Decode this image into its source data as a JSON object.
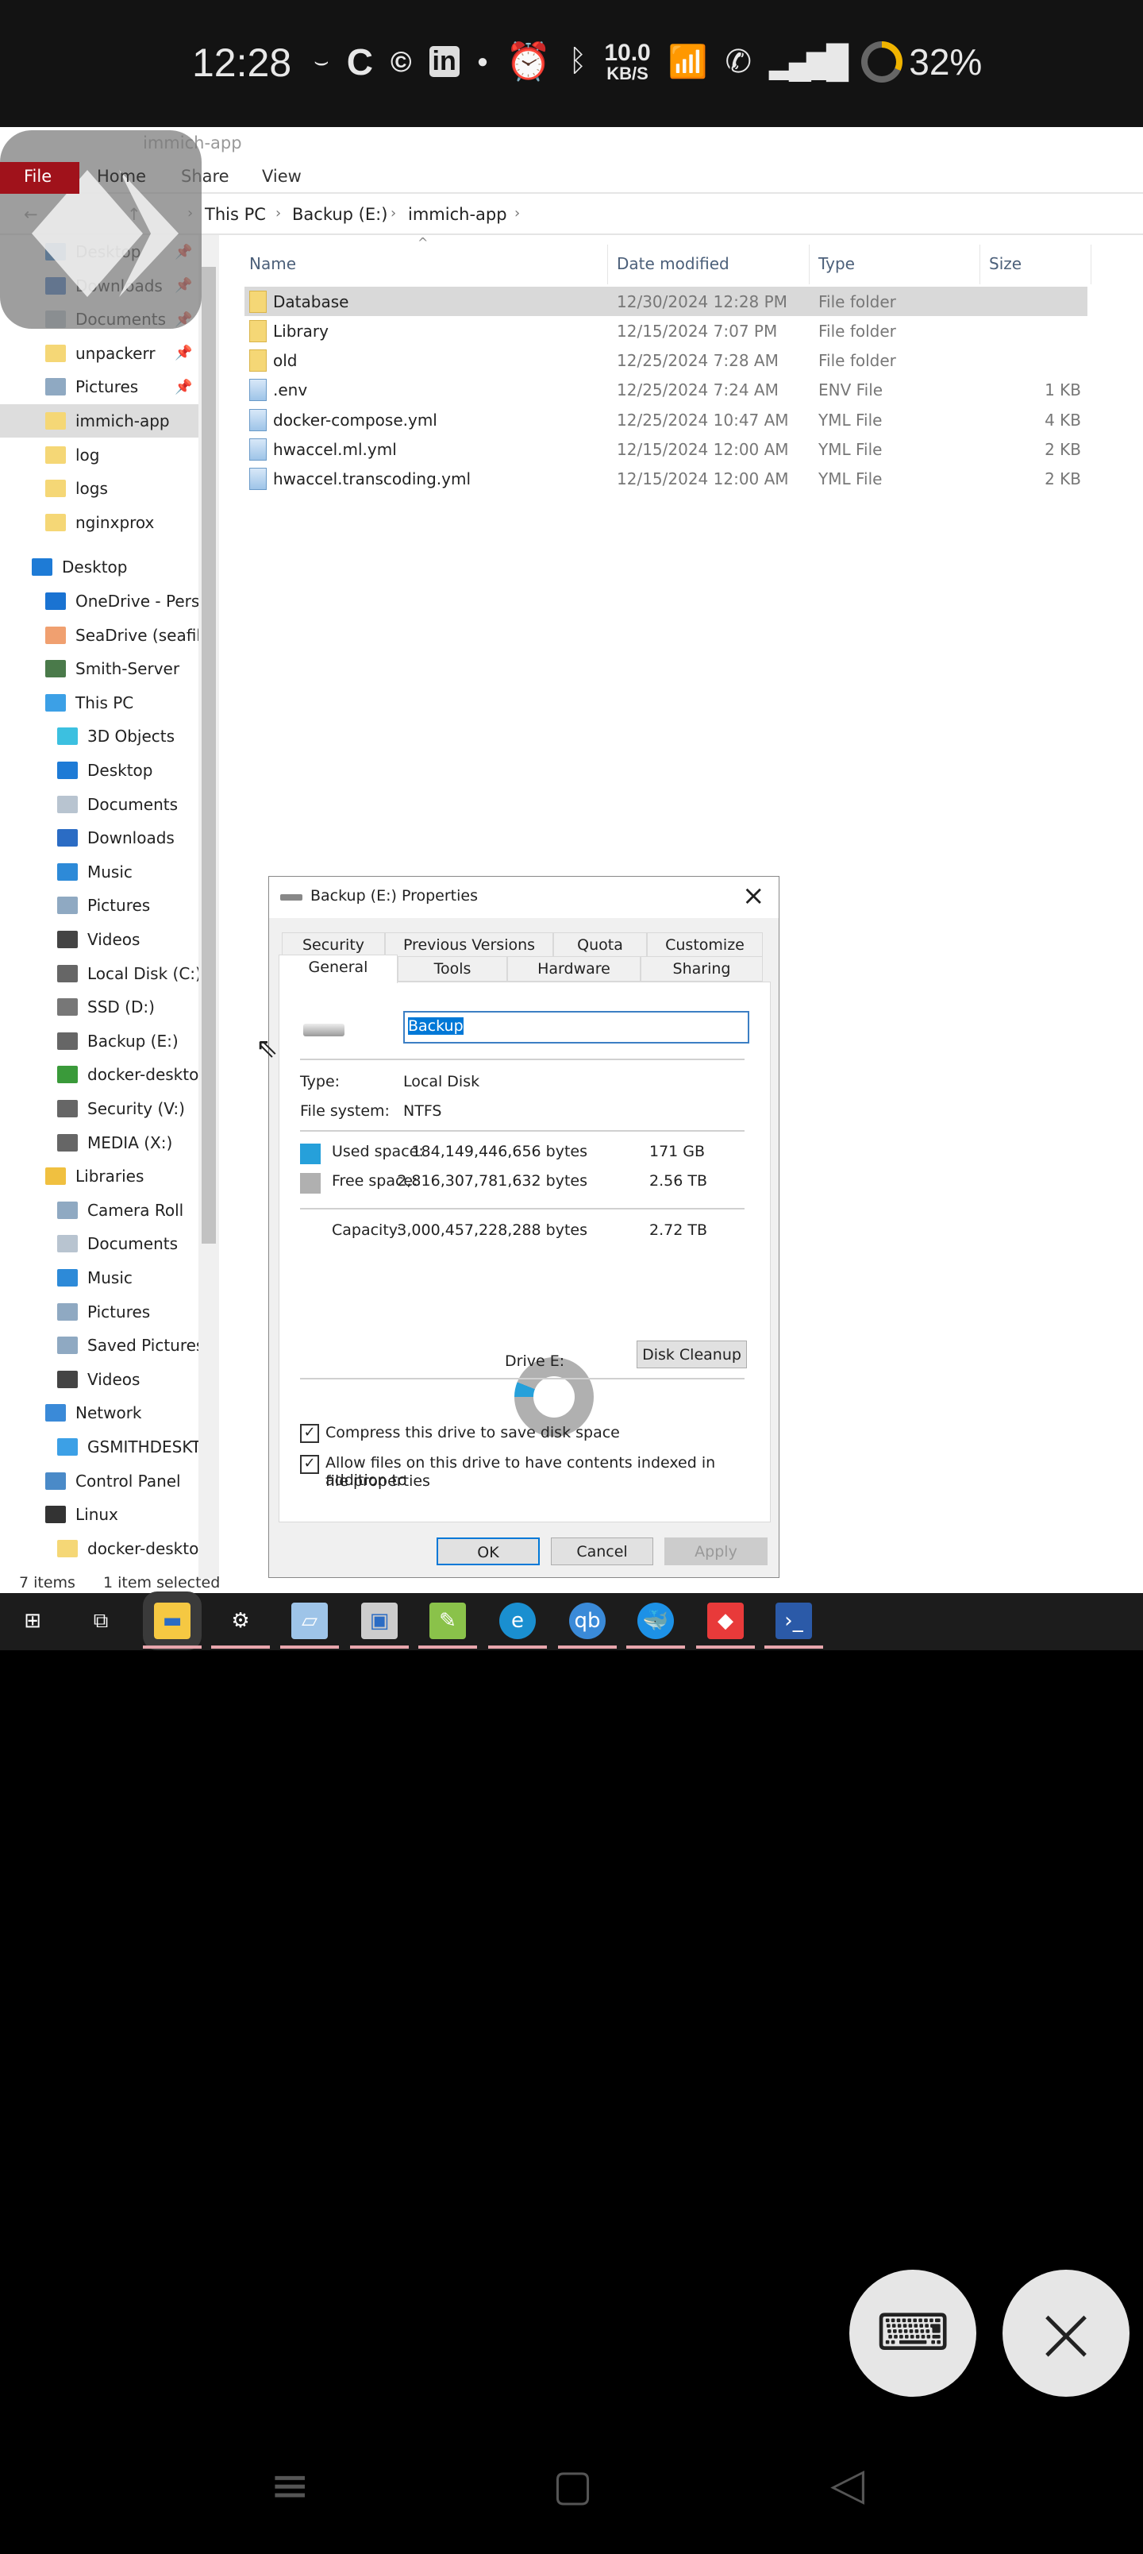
{
  "status_bar": {
    "time": "12:28",
    "speed_value": "10.0",
    "speed_unit": "KB/S",
    "battery": "32%",
    "battery_fraction": 0.32,
    "icons": [
      "amazon-icon",
      "c-icon",
      "c-circle-icon",
      "linkedin-icon",
      "dot-icon",
      "alarm-icon",
      "bluetooth-icon",
      "speed-indicator",
      "wifi-icon",
      "call-wifi-icon",
      "signal-icon",
      "battery-icon"
    ]
  },
  "explorer": {
    "window_title": "immich-app",
    "ribbon_tabs": [
      "File",
      "Home",
      "Share",
      "View"
    ],
    "breadcrumb": [
      "This PC",
      "Backup (E:)",
      "immich-app"
    ],
    "columns": [
      "Name",
      "Date modified",
      "Type",
      "Size"
    ],
    "files": [
      {
        "name": "Database",
        "date": "12/30/2024 12:28 PM",
        "type": "File folder",
        "size": "",
        "kind": "folder",
        "selected": true
      },
      {
        "name": "Library",
        "date": "12/15/2024 7:07 PM",
        "type": "File folder",
        "size": "",
        "kind": "folder"
      },
      {
        "name": "old",
        "date": "12/25/2024 7:28 AM",
        "type": "File folder",
        "size": "",
        "kind": "folder"
      },
      {
        "name": ".env",
        "date": "12/25/2024 7:24 AM",
        "type": "ENV File",
        "size": "1 KB",
        "kind": "file"
      },
      {
        "name": "docker-compose.yml",
        "date": "12/25/2024 10:47 AM",
        "type": "YML File",
        "size": "4 KB",
        "kind": "file"
      },
      {
        "name": "hwaccel.ml.yml",
        "date": "12/15/2024 12:00 AM",
        "type": "YML File",
        "size": "2 KB",
        "kind": "file"
      },
      {
        "name": "hwaccel.transcoding.yml",
        "date": "12/15/2024 12:00 AM",
        "type": "YML File",
        "size": "2 KB",
        "kind": "file"
      }
    ],
    "sidebar": [
      {
        "label": "Desktop",
        "level": 1,
        "icon": "#1e7bd6",
        "pin": true
      },
      {
        "label": "Downloads",
        "level": 1,
        "icon": "#2b6cc4",
        "pin": true
      },
      {
        "label": "Documents",
        "level": 1,
        "icon": "#b8c4d0",
        "pin": true
      },
      {
        "label": "unpackerr",
        "level": 1,
        "icon": "#f5d776",
        "pin": true
      },
      {
        "label": "Pictures",
        "level": 1,
        "icon": "#8fa9c2",
        "pin": true
      },
      {
        "label": "immich-app",
        "level": 1,
        "icon": "#f5d776",
        "selected": true
      },
      {
        "label": "log",
        "level": 1,
        "icon": "#f5d776"
      },
      {
        "label": "logs",
        "level": 1,
        "icon": "#f5d776"
      },
      {
        "label": "nginxprox",
        "level": 1,
        "icon": "#f5d776"
      },
      {
        "label": "Desktop",
        "level": 0,
        "icon": "#1e7bd6",
        "gap": true
      },
      {
        "label": "OneDrive - Perso",
        "level": 1,
        "icon": "#1a73d2"
      },
      {
        "label": "SeaDrive (seafile",
        "level": 1,
        "icon": "#f0a070"
      },
      {
        "label": "Smith-Server",
        "level": 1,
        "icon": "#4a7a4a"
      },
      {
        "label": "This PC",
        "level": 1,
        "icon": "#3ca0e6"
      },
      {
        "label": "3D Objects",
        "level": 2,
        "icon": "#3cc0e0"
      },
      {
        "label": "Desktop",
        "level": 2,
        "icon": "#1e7bd6"
      },
      {
        "label": "Documents",
        "level": 2,
        "icon": "#b8c4d0"
      },
      {
        "label": "Downloads",
        "level": 2,
        "icon": "#2b6cc4"
      },
      {
        "label": "Music",
        "level": 2,
        "icon": "#2d8ad8"
      },
      {
        "label": "Pictures",
        "level": 2,
        "icon": "#8fa9c2"
      },
      {
        "label": "Videos",
        "level": 2,
        "icon": "#444"
      },
      {
        "label": "Local Disk (C:)",
        "level": 2,
        "icon": "#666"
      },
      {
        "label": "SSD (D:)",
        "level": 2,
        "icon": "#777"
      },
      {
        "label": "Backup (E:)",
        "level": 2,
        "icon": "#666"
      },
      {
        "label": "docker-desktop",
        "level": 2,
        "icon": "#3a9a3a"
      },
      {
        "label": "Security (V:)",
        "level": 2,
        "icon": "#666"
      },
      {
        "label": "MEDIA (X:)",
        "level": 2,
        "icon": "#666"
      },
      {
        "label": "Libraries",
        "level": 1,
        "icon": "#f0c040"
      },
      {
        "label": "Camera Roll",
        "level": 2,
        "icon": "#8fa9c2"
      },
      {
        "label": "Documents",
        "level": 2,
        "icon": "#b8c4d0"
      },
      {
        "label": "Music",
        "level": 2,
        "icon": "#2d8ad8"
      },
      {
        "label": "Pictures",
        "level": 2,
        "icon": "#8fa9c2"
      },
      {
        "label": "Saved Pictures",
        "level": 2,
        "icon": "#8fa9c2"
      },
      {
        "label": "Videos",
        "level": 2,
        "icon": "#444"
      },
      {
        "label": "Network",
        "level": 1,
        "icon": "#3a8ad8"
      },
      {
        "label": "GSMITHDESKTO",
        "level": 2,
        "icon": "#3ca0e6"
      },
      {
        "label": "Control Panel",
        "level": 1,
        "icon": "#4a8ac8"
      },
      {
        "label": "Linux",
        "level": 1,
        "icon": "#333"
      },
      {
        "label": "docker-desktop",
        "level": 2,
        "icon": "#f5d776"
      }
    ],
    "status_items": "7 items",
    "status_selected": "1 item selected"
  },
  "dialog": {
    "title": "Backup (E:) Properties",
    "tabs_row1": [
      "Security",
      "Previous Versions",
      "Quota",
      "Customize"
    ],
    "tabs_row2": [
      "General",
      "Tools",
      "Hardware",
      "Sharing"
    ],
    "name_value": "Backup",
    "type_label": "Type:",
    "type_value": "Local Disk",
    "fs_label": "File system:",
    "fs_value": "NTFS",
    "used_label": "Used space:",
    "used_bytes": "184,149,446,656 bytes",
    "used_size": "171 GB",
    "free_label": "Free space:",
    "free_bytes": "2,816,307,781,632 bytes",
    "free_size": "2.56 TB",
    "cap_label": "Capacity:",
    "cap_bytes": "3,000,457,228,288 bytes",
    "cap_size": "2.72 TB",
    "used_fraction": 0.061,
    "used_color": "#26a0da",
    "free_color": "#b0b0b0",
    "drive_label": "Drive E:",
    "disk_cleanup": "Disk Cleanup",
    "compress_label": "Compress this drive to save disk space",
    "index_label_1": "Allow files on this drive to have contents indexed in addition to",
    "index_label_2": "file properties",
    "ok": "OK",
    "cancel": "Cancel",
    "apply": "Apply"
  },
  "taskbar": [
    "start-icon",
    "task-view-icon",
    "file-explorer-icon",
    "settings-icon",
    "notepad-icon",
    "photos-icon",
    "notepadpp-icon",
    "edge-icon",
    "qbittorrent-icon",
    "docker-icon",
    "anydesk-icon",
    "powershell-icon"
  ]
}
